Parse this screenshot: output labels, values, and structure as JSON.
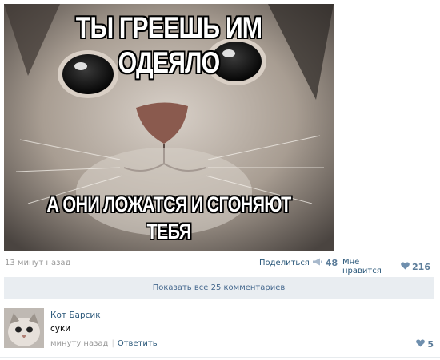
{
  "post": {
    "meme_top": "ТЫ ГРЕЕШЬ ИМ ОДЕЯЛО",
    "meme_bottom_line1": "А ОНИ ЛОЖАТСЯ И СГОНЯЮТ",
    "meme_bottom_line2": "ТЕБЯ",
    "timestamp": "13 минут назад",
    "share_label": "Поделиться",
    "share_count": "48",
    "like_label": "Мне нравится",
    "like_count": "216",
    "share_icon": "megaphone-icon",
    "like_icon": "heart-icon"
  },
  "comments": {
    "show_all_label": "Показать все 25 комментариев",
    "items": [
      {
        "author": "Кот Барсик",
        "text": "суки",
        "time": "минуту назад",
        "reply_label": "Ответить",
        "like_count": "5"
      }
    ]
  },
  "colors": {
    "link": "#2b587a",
    "muted": "#999999",
    "button_bg": "#e9edf1",
    "like_accent": "#5b7c99"
  }
}
